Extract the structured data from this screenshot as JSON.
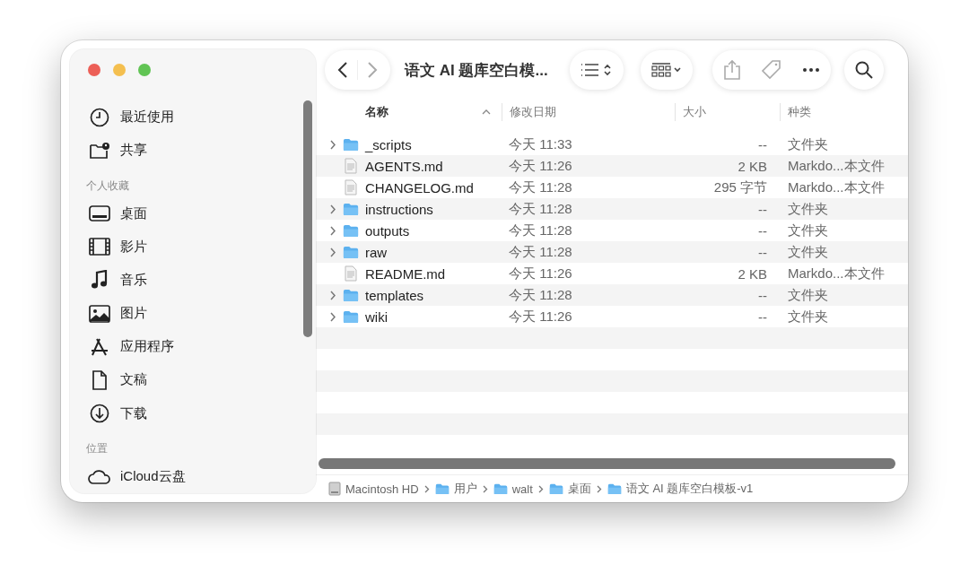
{
  "window": {
    "title": "语文 AI 题库空白模...",
    "controls": [
      {
        "color": "#ec5f57"
      },
      {
        "color": "#f4bf4f"
      },
      {
        "color": "#61c454"
      }
    ]
  },
  "sidebar": {
    "sections": [
      {
        "items": [
          {
            "label": "最近使用",
            "selected": false
          },
          {
            "label": "共享",
            "selected": false
          }
        ]
      },
      {
        "heading": "个人收藏",
        "items": [
          {
            "label": "桌面",
            "selected": false
          },
          {
            "label": "影片",
            "selected": false
          },
          {
            "label": "音乐",
            "selected": false
          },
          {
            "label": "图片",
            "selected": false
          },
          {
            "label": "应用程序",
            "selected": false
          },
          {
            "label": "文稿",
            "selected": false
          },
          {
            "label": "下载",
            "selected": false
          }
        ]
      },
      {
        "heading": "位置",
        "items": [
          {
            "label": "iCloud云盘",
            "selected": false
          }
        ]
      }
    ]
  },
  "table": {
    "columns": [
      {
        "label": "名称",
        "sorted": true
      },
      {
        "label": "修改日期",
        "sorted": false
      },
      {
        "label": "大小",
        "sorted": false
      },
      {
        "label": "种类",
        "sorted": false
      }
    ],
    "rows": [
      {
        "kind": "folder",
        "name": "_scripts",
        "date": "今天 11:33",
        "size": "--",
        "type": "文件夹",
        "expanded": false
      },
      {
        "kind": "file",
        "name": "AGENTS.md",
        "date": "今天 11:26",
        "size": "2 KB",
        "type": "Markdo...本文件"
      },
      {
        "kind": "file",
        "name": "CHANGELOG.md",
        "date": "今天 11:28",
        "size": "295 字节",
        "type": "Markdo...本文件"
      },
      {
        "kind": "folder",
        "name": "instructions",
        "date": "今天 11:28",
        "size": "--",
        "type": "文件夹",
        "expanded": false
      },
      {
        "kind": "folder",
        "name": "outputs",
        "date": "今天 11:28",
        "size": "--",
        "type": "文件夹",
        "expanded": false
      },
      {
        "kind": "folder",
        "name": "raw",
        "date": "今天 11:28",
        "size": "--",
        "type": "文件夹",
        "expanded": false
      },
      {
        "kind": "file",
        "name": "README.md",
        "date": "今天 11:26",
        "size": "2 KB",
        "type": "Markdo...本文件"
      },
      {
        "kind": "folder",
        "name": "templates",
        "date": "今天 11:28",
        "size": "--",
        "type": "文件夹",
        "expanded": false
      },
      {
        "kind": "folder",
        "name": "wiki",
        "date": "今天 11:26",
        "size": "--",
        "type": "文件夹",
        "expanded": false
      }
    ]
  },
  "path_bar": [
    {
      "kind": "disk",
      "label": "Macintosh HD"
    },
    {
      "kind": "folder",
      "label": "用户"
    },
    {
      "kind": "folder",
      "label": "walt"
    },
    {
      "kind": "folder",
      "label": "桌面"
    },
    {
      "kind": "folder",
      "label": "语文 AI 题库空白模板-v1"
    }
  ]
}
